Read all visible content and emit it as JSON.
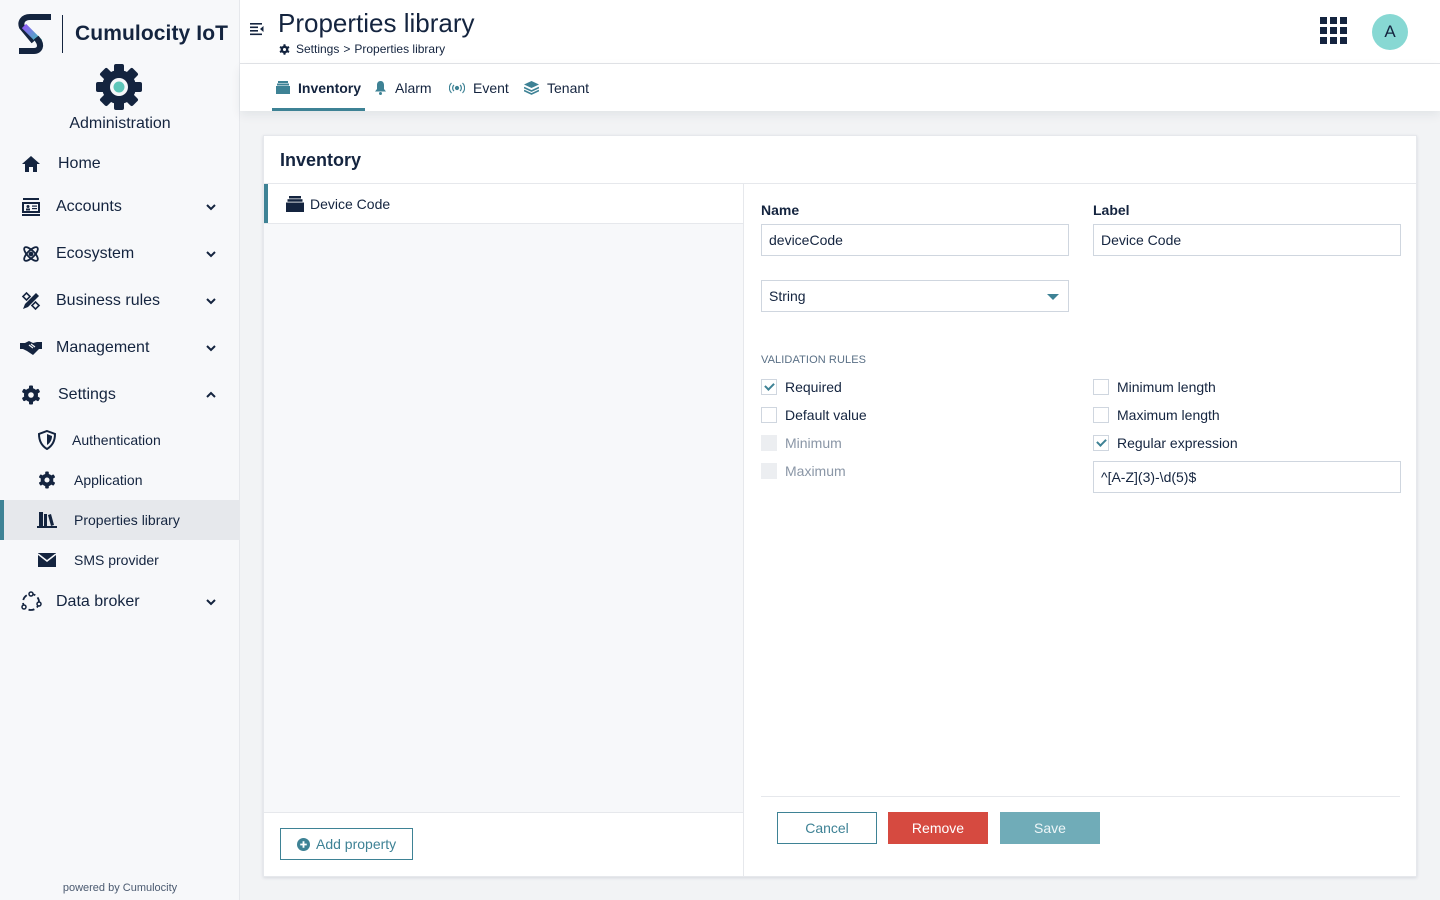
{
  "brand": {
    "name": "Cumulocity IoT",
    "app_name": "Administration"
  },
  "sidebar": {
    "items": [
      {
        "label": "Home",
        "icon": "home-icon",
        "expandable": false
      },
      {
        "label": "Accounts",
        "icon": "accounts-icon",
        "expandable": true,
        "expanded": false
      },
      {
        "label": "Ecosystem",
        "icon": "atom-icon",
        "expandable": true,
        "expanded": false
      },
      {
        "label": "Business rules",
        "icon": "ruler-pencil-icon",
        "expandable": true,
        "expanded": false
      },
      {
        "label": "Management",
        "icon": "handshake-icon",
        "expandable": true,
        "expanded": false
      },
      {
        "label": "Settings",
        "icon": "gear-icon",
        "expandable": true,
        "expanded": true
      },
      {
        "label": "Data broker",
        "icon": "data-broker-icon",
        "expandable": true,
        "expanded": false
      }
    ],
    "settings_children": [
      {
        "label": "Authentication",
        "icon": "shield-icon",
        "active": false
      },
      {
        "label": "Application",
        "icon": "gear-icon",
        "active": false
      },
      {
        "label": "Properties library",
        "icon": "library-icon",
        "active": true
      },
      {
        "label": "SMS provider",
        "icon": "envelope-icon",
        "active": false
      }
    ],
    "footer": "powered by Cumulocity"
  },
  "header": {
    "title": "Properties library",
    "breadcrumb": {
      "parent": "Settings",
      "separator": ">",
      "current": "Properties library"
    },
    "avatar_initial": "A"
  },
  "tabs": [
    {
      "label": "Inventory",
      "icon": "inventory-icon",
      "active": true
    },
    {
      "label": "Alarm",
      "icon": "bell-icon",
      "active": false
    },
    {
      "label": "Event",
      "icon": "broadcast-icon",
      "active": false
    },
    {
      "label": "Tenant",
      "icon": "layers-icon",
      "active": false
    }
  ],
  "card": {
    "title": "Inventory",
    "properties": [
      {
        "label": "Device Code",
        "selected": true
      }
    ],
    "add_property_label": "Add property"
  },
  "form": {
    "name_label": "Name",
    "name_value": "deviceCode",
    "label_label": "Label",
    "label_value": "Device Code",
    "type_value": "String",
    "validation_title": "VALIDATION RULES",
    "rules_left": [
      {
        "label": "Required",
        "checked": true,
        "disabled": false
      },
      {
        "label": "Default value",
        "checked": false,
        "disabled": false
      },
      {
        "label": "Minimum",
        "checked": false,
        "disabled": true
      },
      {
        "label": "Maximum",
        "checked": false,
        "disabled": true
      }
    ],
    "rules_right": [
      {
        "label": "Minimum length",
        "checked": false,
        "disabled": false
      },
      {
        "label": "Maximum length",
        "checked": false,
        "disabled": false
      },
      {
        "label": "Regular expression",
        "checked": true,
        "disabled": false
      }
    ],
    "regex_value": "^[A-Z](3)-\\d(5)$",
    "buttons": {
      "cancel": "Cancel",
      "remove": "Remove",
      "save": "Save"
    }
  },
  "colors": {
    "accent": "#3e8295",
    "danger": "#d64a40",
    "save": "#70acb8",
    "avatar": "#87d8d3",
    "text": "#14243f"
  }
}
